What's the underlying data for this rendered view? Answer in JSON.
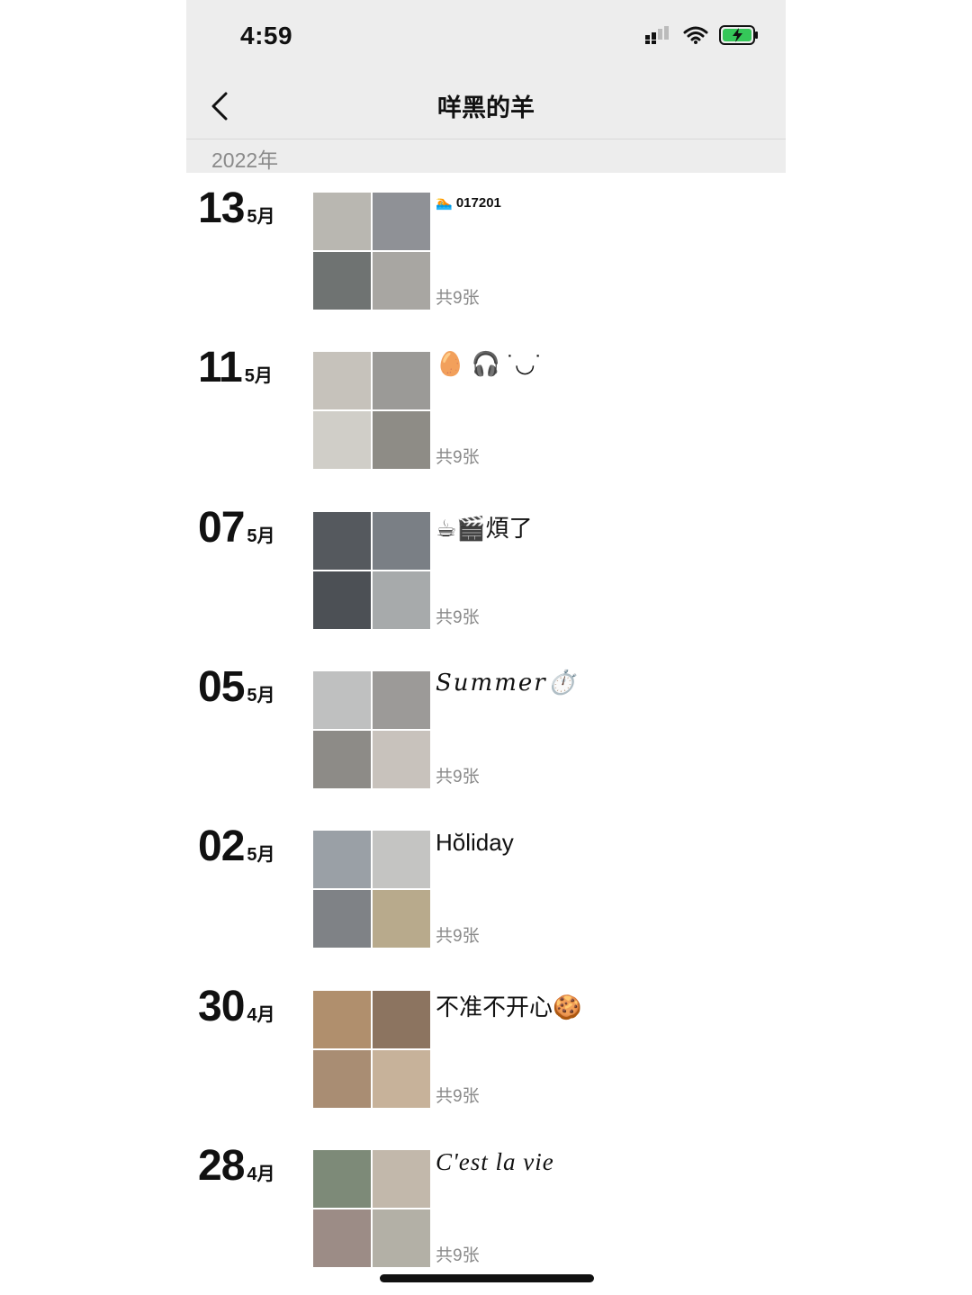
{
  "status_bar": {
    "time": "4:59"
  },
  "nav": {
    "title": "咩黑的羊"
  },
  "year_header": "2022年",
  "entries": [
    {
      "day": "13",
      "month": "5月",
      "caption": "🏊 017201",
      "count": "共9张",
      "thumb_colors": [
        "#b9b7b1",
        "#8f9196",
        "#6f7372",
        "#a8a6a2"
      ]
    },
    {
      "day": "11",
      "month": "5月",
      "caption": "🥚 🎧 ˙◡˙",
      "count": "共9张",
      "thumb_colors": [
        "#c6c2bb",
        "#9b9a97",
        "#d0cec8",
        "#8e8c86"
      ]
    },
    {
      "day": "07",
      "month": "5月",
      "caption": "☕🎬煩了",
      "count": "共9张",
      "thumb_colors": [
        "#55595e",
        "#7a7f85",
        "#4c5055",
        "#a7aaab"
      ]
    },
    {
      "day": "05",
      "month": "5月",
      "caption": "Summer⏱️",
      "count": "共9张",
      "thumb_colors": [
        "#bfc0c0",
        "#9c9a98",
        "#8d8b87",
        "#c8c2bc"
      ]
    },
    {
      "day": "02",
      "month": "5月",
      "caption": "Hŏliday",
      "count": "共9张",
      "thumb_colors": [
        "#9aa0a6",
        "#c4c4c2",
        "#7f8286",
        "#b8aa8c"
      ]
    },
    {
      "day": "30",
      "month": "4月",
      "caption": "不准不开心🍪",
      "count": "共9张",
      "thumb_colors": [
        "#b08f6d",
        "#8c7460",
        "#a98d73",
        "#c7b29a"
      ]
    },
    {
      "day": "28",
      "month": "4月",
      "caption": "C'est la vie",
      "count": "共9张",
      "thumb_colors": [
        "#7d8a78",
        "#c2b8ab",
        "#9c8c86",
        "#b3b0a6"
      ]
    }
  ],
  "icons": [
    "back-arrow",
    "signal",
    "wifi",
    "battery-charging"
  ],
  "colors": {
    "header_bg": "#ededed",
    "muted_text": "#8a8a8a",
    "battery_green": "#35c759"
  }
}
